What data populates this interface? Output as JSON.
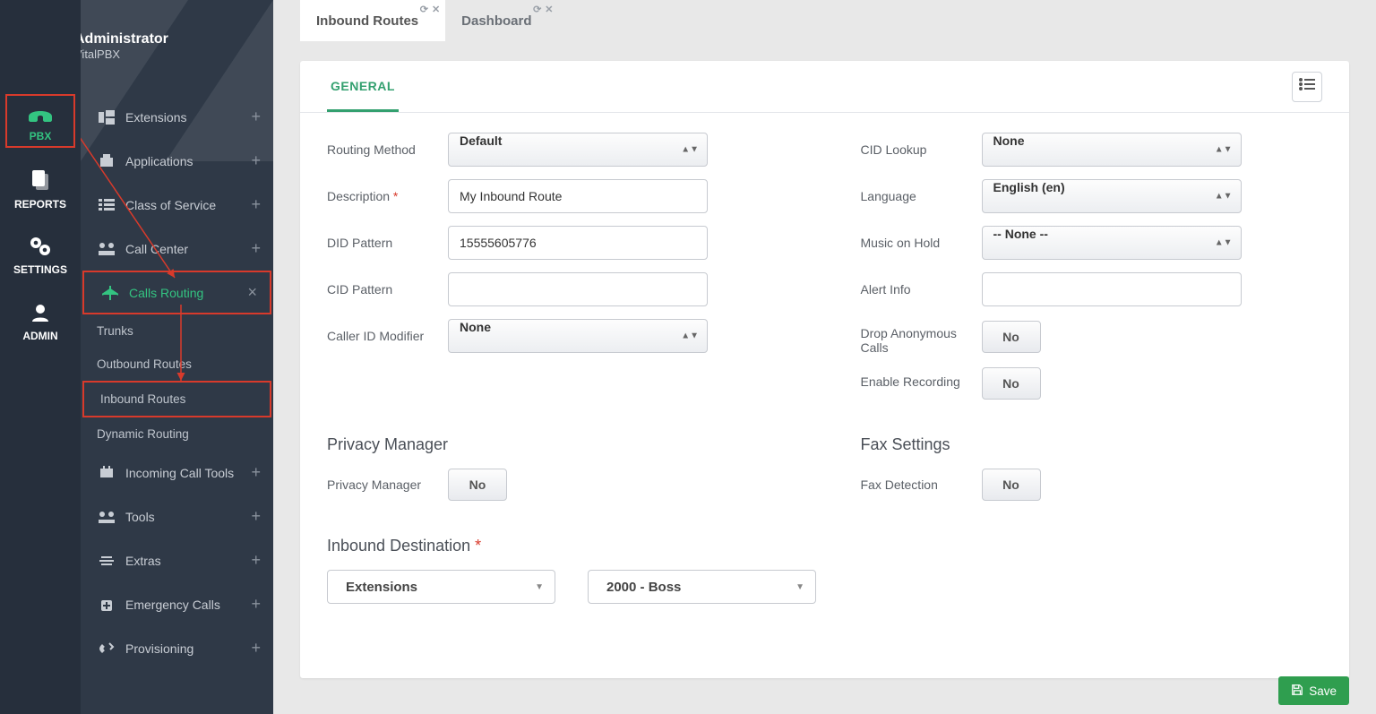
{
  "user": {
    "name": "Administrator",
    "sub": "VitalPBX"
  },
  "rail": {
    "pbx": "PBX",
    "reports": "REPORTS",
    "settings": "SETTINGS",
    "admin": "ADMIN"
  },
  "menu": {
    "extensions": "Extensions",
    "applications": "Applications",
    "cos": "Class of Service",
    "callcenter": "Call Center",
    "callsrouting": "Calls Routing",
    "trunks": "Trunks",
    "outbound": "Outbound Routes",
    "inbound": "Inbound Routes",
    "dynamic": "Dynamic Routing",
    "incoming_tools": "Incoming Call Tools",
    "tools": "Tools",
    "extras": "Extras",
    "emergency": "Emergency Calls",
    "provisioning": "Provisioning"
  },
  "tabs": {
    "inbound": "Inbound Routes",
    "dashboard": "Dashboard"
  },
  "panel_tab": "GENERAL",
  "labels": {
    "routing_method": "Routing Method",
    "description": "Description",
    "did_pattern": "DID Pattern",
    "cid_pattern": "CID Pattern",
    "callerid_modifier": "Caller ID Modifier",
    "cid_lookup": "CID Lookup",
    "language": "Language",
    "moh": "Music on Hold",
    "alert_info": "Alert Info",
    "drop_anon": "Drop Anonymous Calls",
    "enable_rec": "Enable Recording",
    "privacy_section": "Privacy Manager",
    "privacy_manager": "Privacy Manager",
    "fax_section": "Fax Settings",
    "fax_detection": "Fax Detection",
    "inbound_dest": "Inbound Destination"
  },
  "values": {
    "routing_method": "Default",
    "description": "My Inbound Route",
    "did_pattern": "15555605776",
    "cid_pattern": "",
    "callerid_modifier": "None",
    "cid_lookup": "None",
    "language": "English (en)",
    "moh": "-- None --",
    "alert_info": "",
    "drop_anon": "No",
    "enable_rec": "No",
    "privacy_manager": "No",
    "fax_detection": "No",
    "dest_module": "Extensions",
    "dest_target": "2000 - Boss"
  },
  "buttons": {
    "save": "Save"
  },
  "colors": {
    "accent": "#33c481",
    "highlight": "#d83a2b",
    "save": "#2f9e4f"
  }
}
